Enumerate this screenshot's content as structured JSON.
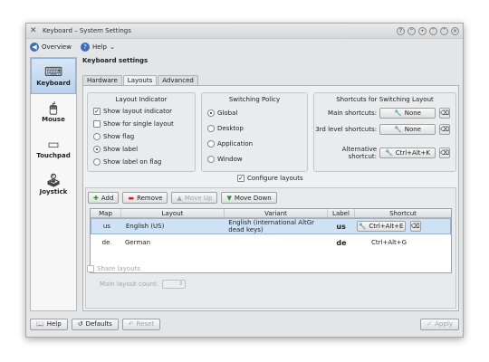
{
  "window": {
    "title": "Keyboard – System Settings"
  },
  "toolbar": {
    "overview": "Overview",
    "help": "Help",
    "help_arrow": "⌄"
  },
  "sidebar": {
    "items": [
      {
        "label": "Keyboard",
        "icon": "keyboard-icon"
      },
      {
        "label": "Mouse",
        "icon": "mouse-icon"
      },
      {
        "label": "Touchpad",
        "icon": "touchpad-icon"
      },
      {
        "label": "Joystick",
        "icon": "joystick-icon"
      }
    ]
  },
  "content": {
    "heading": "Keyboard settings",
    "tabs": [
      "Hardware",
      "Layouts",
      "Advanced"
    ]
  },
  "layout_indicator": {
    "title": "Layout Indicator",
    "options": [
      {
        "label": "Show layout indicator",
        "checked": true
      },
      {
        "label": "Show for single layout",
        "checked": false
      },
      {
        "label": "Show flag",
        "checked": false
      },
      {
        "label": "Show label",
        "checked": true
      },
      {
        "label": "Show label on flag",
        "checked": false
      }
    ]
  },
  "switching_policy": {
    "title": "Switching Policy",
    "options": [
      {
        "label": "Global",
        "selected": true
      },
      {
        "label": "Desktop",
        "selected": false
      },
      {
        "label": "Application",
        "selected": false
      },
      {
        "label": "Window",
        "selected": false
      }
    ]
  },
  "shortcuts": {
    "title": "Shortcuts for Switching Layout",
    "rows": [
      {
        "label": "Main shortcuts:",
        "value": "None"
      },
      {
        "label": "3rd level shortcuts:",
        "value": "None"
      },
      {
        "label": "Alternative shortcut:",
        "value": "Ctrl+Alt+K"
      }
    ]
  },
  "configure_layouts": "Configure layouts",
  "layout_buttons": {
    "add": "Add",
    "remove": "Remove",
    "move_up": "Move Up",
    "move_down": "Move Down"
  },
  "table": {
    "headers": [
      "Map",
      "Layout",
      "Variant",
      "Label",
      "Shortcut"
    ],
    "rows": [
      {
        "map": "us",
        "layout": "English (US)",
        "variant": "English (international AltGr dead keys)",
        "label": "us",
        "shortcut": "Ctrl+Alt+E"
      },
      {
        "map": "de",
        "layout": "German",
        "variant": "",
        "label": "de",
        "shortcut": "Ctrl+Alt+G"
      }
    ]
  },
  "share_layouts": "Share layouts",
  "main_layout_count": "Main layout count:",
  "footer": {
    "help": "Help",
    "defaults": "Defaults",
    "reset": "Reset",
    "apply": "Apply"
  }
}
